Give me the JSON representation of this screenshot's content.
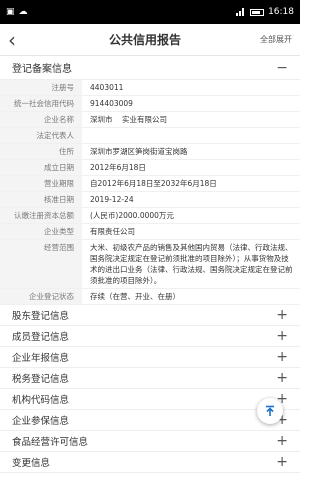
{
  "status_bar": {
    "time": "16:18"
  },
  "nav": {
    "title": "公共信用报告",
    "expand_all": "全部展开"
  },
  "section": {
    "title": "登记备案信息",
    "toggle": "−"
  },
  "fields": [
    {
      "label": "注册号",
      "value": "4403011"
    },
    {
      "label": "统一社会信用代码",
      "value": "914403009"
    },
    {
      "label": "企业名称",
      "value": "深圳市    实业有限公司"
    },
    {
      "label": "法定代表人",
      "value": ""
    },
    {
      "label": "住所",
      "value": "深圳市罗湖区笋岗街道宝岗路"
    },
    {
      "label": "成立日期",
      "value": "2012年6月18日"
    },
    {
      "label": "营业期限",
      "value": "自2012年6月18日至2032年6月18日"
    },
    {
      "label": "核准日期",
      "value": "2019-12-24"
    },
    {
      "label": "认缴注册资本总额",
      "value": "(人民币)2000.0000万元"
    },
    {
      "label": "企业类型",
      "value": "有限责任公司"
    },
    {
      "label": "经营范围",
      "value": "大米、初级农产品的销售及其他国内贸易（法律、行政法规、国务院决定规定在登记前须批准的项目除外）；从事货物及技术的进出口业务（法律、行政法规、国务院决定规定在登记前须批准的项目除外）。"
    },
    {
      "label": "企业登记状态",
      "value": "存续（在营、开业、在册）"
    }
  ],
  "collapsed_sections": [
    "股东登记信息",
    "成员登记信息",
    "企业年报信息",
    "税务登记信息",
    "机构代码信息",
    "企业参保信息",
    "食品经营许可信息",
    "变更信息"
  ],
  "plus_sign": "+",
  "icons": {
    "back": "chevron-left-icon",
    "fab": "arrow-up-to-top-icon"
  },
  "colors": {
    "fab_arrow": "#1a73c9"
  }
}
